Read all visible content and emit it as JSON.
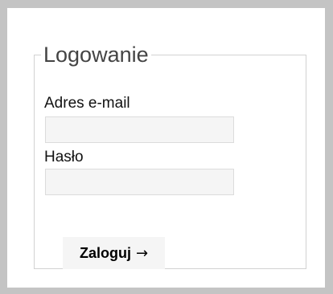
{
  "login": {
    "title": "Logowanie",
    "email_label": "Adres e-mail",
    "email_value": "",
    "password_label": "Hasło",
    "password_value": "",
    "submit_label": "Zaloguj",
    "submit_icon": "arrow-right-icon",
    "submit_icon_glyph": "→"
  },
  "colors": {
    "page_background": "#c4c4c4",
    "panel_background": "#ffffff",
    "fieldset_border": "#d2d2d2",
    "input_background": "#f5f5f5",
    "button_background": "#f5f5f5"
  }
}
